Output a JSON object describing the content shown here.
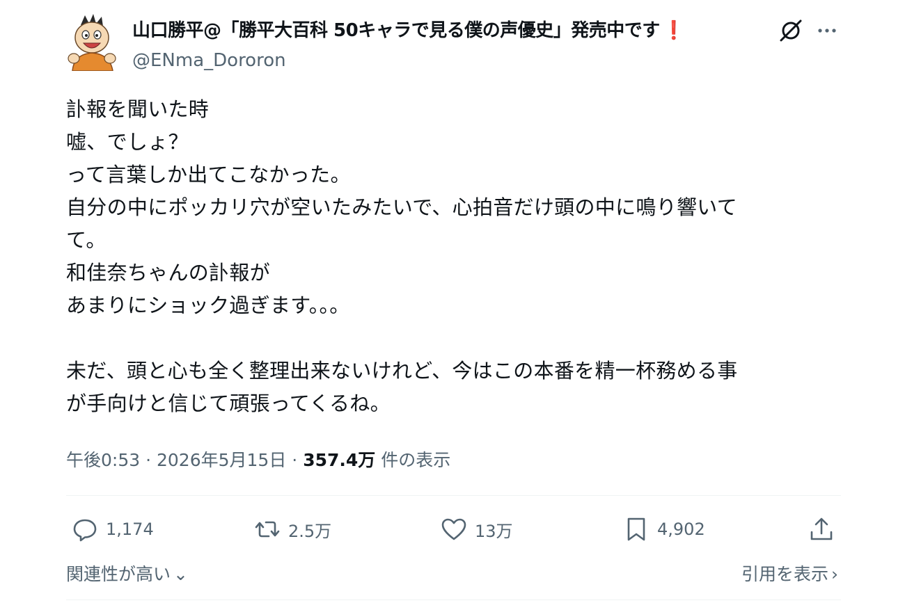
{
  "author": {
    "display_name": "山口勝平@「勝平大百科 50キャラで見る僕の声優史」発売中です",
    "name_emoji": "❗",
    "handle": "@ENma_Dororon",
    "avatar_icon": "cartoon-avatar-icon"
  },
  "header_icons": {
    "grok": "grok-icon",
    "more": "more-icon"
  },
  "body": {
    "lines": [
      "訃報を聞いた時",
      "嘘、でしょ？",
      "って言葉しか出てこなかった。",
      "自分の中にポッカリ穴が空いたみたいで、心拍音だけ頭の中に鳴り響いて",
      "て。",
      "和佳奈ちゃんの訃報が",
      "あまりにショック過ぎます。。。",
      "",
      "未だ、頭と心も全く整理出来ないけれど、今はこの本番を精一杯務める事",
      "が手向けと信じて頑張ってくるね。"
    ]
  },
  "meta": {
    "time": "午後0:53",
    "separator": "·",
    "date": "2026年5月15日",
    "views_count": "357.4万",
    "views_label": "件の表示"
  },
  "actions": {
    "replies": "1,174",
    "retweets": "2.5万",
    "likes": "13万",
    "bookmarks": "4,902"
  },
  "footer": {
    "sort_label": "関連性が高い",
    "sort_chevron": "⌄",
    "quotes_label": "引用を表示",
    "quotes_chevron": "›"
  },
  "colors": {
    "text": "#0f1419",
    "secondary": "#536471",
    "divider": "#eff3f4",
    "exclaim": "#e0102a"
  }
}
